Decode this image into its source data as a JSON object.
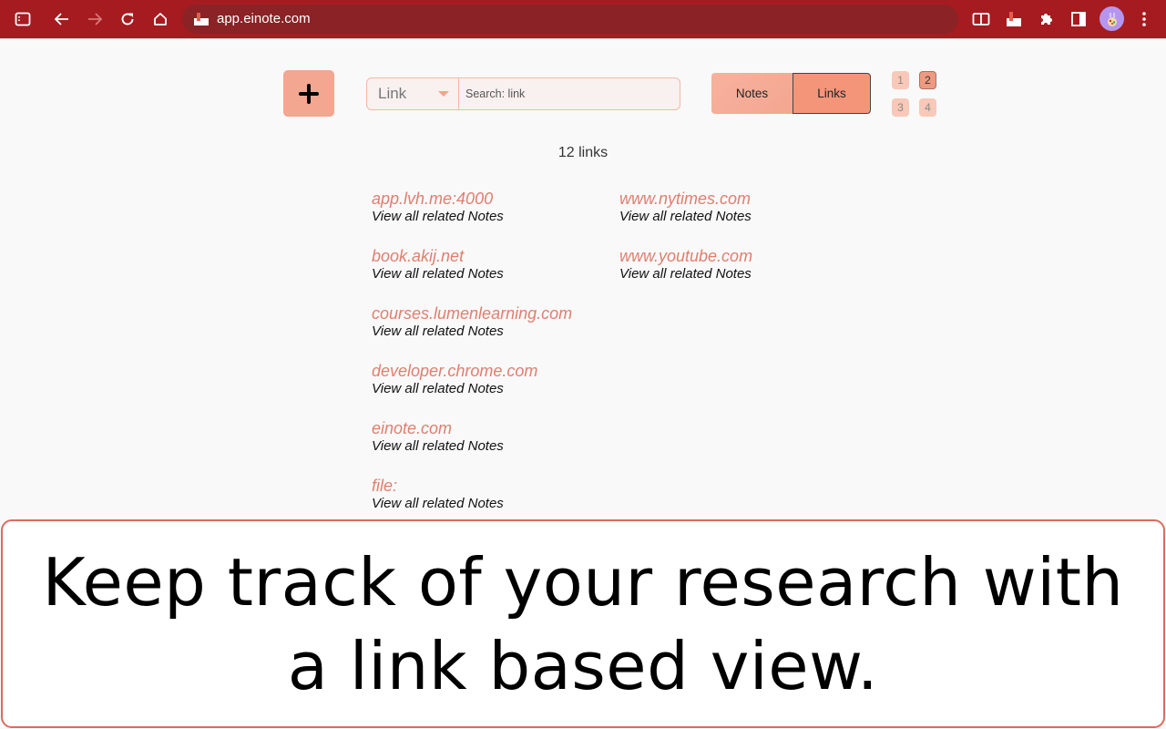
{
  "browser": {
    "url": "app.einote.com",
    "icons": [
      "sidebar-toggle-icon",
      "back-icon",
      "forward-icon",
      "reload-icon",
      "home-icon",
      "reading-mode-icon",
      "einote-extension-icon",
      "extensions-puzzle-icon",
      "side-panel-icon",
      "profile-avatar",
      "kebab-menu-icon"
    ]
  },
  "toolbar": {
    "add_label": "+",
    "filter_select": {
      "selected": "Link"
    },
    "search": {
      "value": "",
      "placeholder": "Search: link"
    },
    "view_toggle": {
      "options": [
        {
          "label": "Notes",
          "active": false
        },
        {
          "label": "Links",
          "active": true
        }
      ]
    },
    "pagination": {
      "pages": [
        "1",
        "2",
        "3",
        "4"
      ],
      "current": "2"
    }
  },
  "links": {
    "count_label": "12 links",
    "sub_label": "View all related Notes",
    "items": [
      {
        "domain": "app.lvh.me:4000",
        "sub": "View all related Notes"
      },
      {
        "domain": "book.akij.net",
        "sub": "View all related Notes"
      },
      {
        "domain": "courses.lumenlearning.com",
        "sub": "View all related Notes"
      },
      {
        "domain": "developer.chrome.com",
        "sub": "View all related Notes"
      },
      {
        "domain": "einote.com",
        "sub": "View all related Notes"
      },
      {
        "domain": "file:",
        "sub": "View all related Notes"
      },
      {
        "domain": "www.nytimes.com",
        "sub": "View all related Notes"
      },
      {
        "domain": "www.youtube.com",
        "sub": "View all related Notes"
      }
    ]
  },
  "caption": {
    "text": "Keep track of your research with a link based view."
  },
  "colors": {
    "chrome_bar": "#a61b1f",
    "accent": "#f3a690",
    "link_text": "#e07e6f",
    "caption_border": "#dc6c5e"
  }
}
